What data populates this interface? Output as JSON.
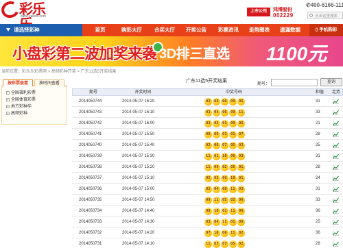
{
  "header": {
    "logo_text": "彩乐乐",
    "logo_url": "www.cailele.com",
    "stock_badge": "上市公司",
    "stock_name": "鸿博股份",
    "stock_code": "002229",
    "hotline": "400-6166-111",
    "search_placeholder": "点击这里搜索"
  },
  "nav": {
    "category_label": "请选择彩种",
    "items": [
      "首页",
      "购彩大厅",
      "合买大厅",
      "开奖公告",
      "彩票资讯",
      "走势图表",
      "遗漏数据"
    ],
    "phone_label": "手机购彩",
    "accent": "#e8411a",
    "category_color": "#1d5fae"
  },
  "banner": {
    "text_left": "小盘彩第二波加奖来袭",
    "text_right": "3D排三直选",
    "big_number": "1100元"
  },
  "breadcrumb": "当前位置：彩乐乐彩票网 > 高频彩种开奖 > 广东11选5开奖结果",
  "sidebar": {
    "tabs": [
      "按彩票查看",
      "按时间查看"
    ],
    "items": [
      "全国福利彩票",
      "全国体育彩票",
      "地方彩种华",
      "高频彩种"
    ]
  },
  "main": {
    "title": "广东11选5开奖结果",
    "period_label": "期号：",
    "query_button": "查询",
    "columns": [
      "期号",
      "开奖时间",
      "中奖号码",
      "和值",
      "走势"
    ],
    "rows": [
      {
        "period": "2014050744",
        "time": "2014-05-07 16:20",
        "numbers": [
          "03",
          "08",
          "06",
          "09",
          "05"
        ],
        "sum": "31"
      },
      {
        "period": "2014050743",
        "time": "2014-05-07 16:10",
        "numbers": [
          "03",
          "04",
          "06",
          "09",
          "11"
        ],
        "sum": "33"
      },
      {
        "period": "2014050742",
        "time": "2014-05-07 16:00",
        "numbers": [
          "03",
          "02",
          "01",
          "09",
          "06"
        ],
        "sum": "21"
      },
      {
        "period": "2014050741",
        "time": "2014-05-07 15:50",
        "numbers": [
          "08",
          "09",
          "03",
          "01",
          "07"
        ],
        "sum": "28"
      },
      {
        "period": "2014050740",
        "time": "2014-05-07 15:40",
        "numbers": [
          "02",
          "08",
          "07",
          "05",
          "03"
        ],
        "sum": "25"
      },
      {
        "period": "2014050739",
        "time": "2014-05-07 15:30",
        "numbers": [
          "11",
          "01",
          "10",
          "06",
          "03"
        ],
        "sum": "31"
      },
      {
        "period": "2014050738",
        "time": "2014-05-07 15:20",
        "numbers": [
          "11",
          "09",
          "02",
          "05",
          "01"
        ],
        "sum": "28"
      },
      {
        "period": "2014050737",
        "time": "2014-05-07 15:10",
        "numbers": [
          "02",
          "05",
          "06",
          "10",
          "01"
        ],
        "sum": "24"
      },
      {
        "period": "2014050736",
        "time": "2014-05-07 15:00",
        "numbers": [
          "05",
          "04",
          "08",
          "11",
          "03"
        ],
        "sum": "31"
      },
      {
        "period": "2014050735",
        "time": "2014-05-07 14:50",
        "numbers": [
          "09",
          "11",
          "05",
          "02",
          "06"
        ],
        "sum": "33"
      },
      {
        "period": "2014050734",
        "time": "2014-05-07 14:40",
        "numbers": [
          "08",
          "10",
          "01",
          "11",
          "06"
        ],
        "sum": "36"
      },
      {
        "period": "2014050733",
        "time": "2014-05-07 14:30",
        "numbers": [
          "03",
          "04",
          "11",
          "01",
          "06"
        ],
        "sum": "25"
      },
      {
        "period": "2014050732",
        "time": "2014-05-07 14:20",
        "numbers": [
          "07",
          "10",
          "06",
          "11",
          "02"
        ],
        "sum": "36"
      },
      {
        "period": "2014050731",
        "time": "2014-05-07 14:10",
        "numbers": [
          "11",
          "03",
          "07",
          "05",
          "02"
        ],
        "sum": "28"
      }
    ]
  }
}
